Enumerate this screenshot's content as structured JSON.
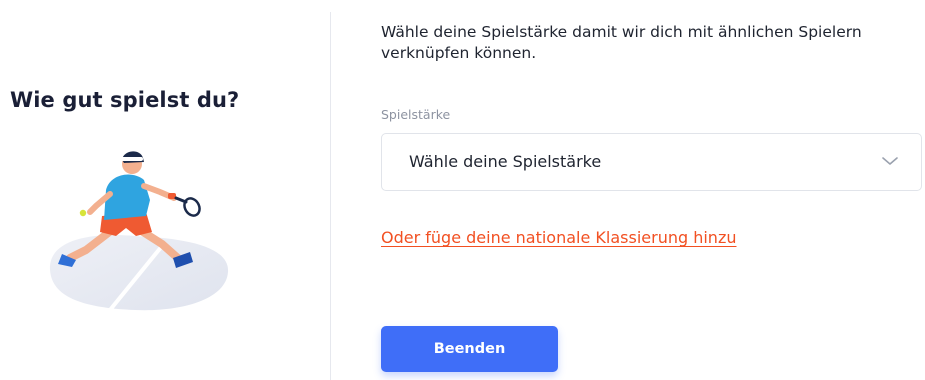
{
  "left": {
    "title": "Wie gut spielst du?",
    "illustration": "tennis-player-illustration"
  },
  "right": {
    "intro": "Wähle deine Spielstärke damit wir dich mit ähnlichen Spielern verknüpfen können.",
    "field_label": "Spielstärke",
    "select_value": "Wähle deine Spielstärke",
    "select_icon": "chevron-down-icon",
    "ranking_link": "Oder füge deine nationale Klassierung hinzu",
    "finish_button": "Beenden"
  },
  "colors": {
    "accent": "#3f6ef8",
    "link": "#f25022",
    "title": "#1a1f36",
    "label": "#8d93a1",
    "border": "#e1e4ea"
  }
}
